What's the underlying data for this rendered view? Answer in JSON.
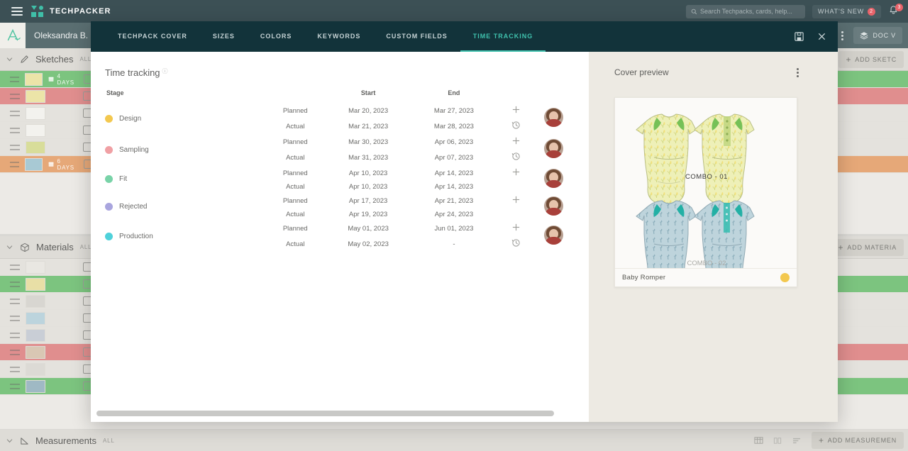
{
  "topbar": {
    "menu_icon": "hamburger-icon",
    "brand": "TECHPACKER",
    "search_placeholder": "Search Techpacks, cards, help...",
    "search_icon": "search-icon",
    "whats_new_label": "WHAT'S NEW",
    "whats_new_badge": "2",
    "bell_icon": "bell-icon",
    "bell_badge": "3"
  },
  "subbar": {
    "logo_glyph": "A",
    "user_name": "Oleksandra B.",
    "filter_icon": "filter-icon",
    "kebab_icon": "kebab-menu-icon",
    "doc_view_label": "DOC V",
    "doc_view_icon": "layers-icon"
  },
  "sections": {
    "sketches": {
      "title": "Sketches",
      "sub": "ALL",
      "icon": "pencil-icon",
      "sort_icon": "sort-icon",
      "add_label": "ADD SKETC",
      "rows": [
        {
          "highlight": "#7cc47f",
          "days": "4 DAYS",
          "swatch": "#ece4a8"
        },
        {
          "highlight": "#e08e8e",
          "days": "",
          "swatch": "#ece4a8"
        },
        {
          "highlight": "",
          "days": "",
          "swatch": "#f3f2ee"
        },
        {
          "highlight": "",
          "days": "",
          "swatch": "#f3f2ee"
        },
        {
          "highlight": "",
          "days": "",
          "swatch": "#d8dd9a"
        },
        {
          "highlight": "#e6a878",
          "days": "6 DAYS",
          "swatch": "#a8c9d4"
        }
      ]
    },
    "materials": {
      "title": "Materials",
      "sub": "ALL",
      "icon": "cube-icon",
      "add_label": "ADD MATERIA",
      "rows": [
        {
          "highlight": "",
          "swatch": "#e9e7e2"
        },
        {
          "highlight": "#7cc47f",
          "swatch": "#e8dfa6"
        },
        {
          "highlight": "",
          "swatch": "#d8d6d1"
        },
        {
          "highlight": "",
          "swatch": "#bcd4dd"
        },
        {
          "highlight": "",
          "swatch": "#c9ced6"
        },
        {
          "highlight": "#e08e8e",
          "swatch": "#d9c7b4"
        },
        {
          "highlight": "",
          "swatch": "#dcdad5"
        },
        {
          "highlight": "#7cc47f",
          "swatch": "#9fb9c4"
        }
      ]
    },
    "measurements": {
      "title": "Measurements",
      "sub": "ALL",
      "icon": "ruler-icon",
      "add_label": "ADD MEASUREMEN"
    }
  },
  "modal": {
    "tabs": [
      {
        "label": "TECHPACK COVER",
        "active": false
      },
      {
        "label": "SIZES",
        "active": false
      },
      {
        "label": "COLORS",
        "active": false
      },
      {
        "label": "KEYWORDS",
        "active": false
      },
      {
        "label": "CUSTOM FIELDS",
        "active": false
      },
      {
        "label": "TIME TRACKING",
        "active": true
      }
    ],
    "save_icon": "save-icon",
    "close_icon": "close-icon",
    "time_tracking": {
      "title": "Time tracking",
      "info_icon": "info-icon",
      "columns": {
        "stage": "Stage",
        "start": "Start",
        "end": "End"
      },
      "row_labels": {
        "planned": "Planned",
        "actual": "Actual"
      },
      "add_icon": "plus-icon",
      "history_icon": "clock-history-icon",
      "avatar_icon": "avatar",
      "stages": [
        {
          "name": "Design",
          "color": "#f3c84f",
          "planned_start": "Mar 20, 2023",
          "planned_end": "Mar 27, 2023",
          "planned_end_late": true,
          "actual_start": "Mar 21, 2023",
          "actual_end": "Mar 28, 2023",
          "has_history": true
        },
        {
          "name": "Sampling",
          "color": "#f0a0a4",
          "planned_start": "Mar 30, 2023",
          "planned_end": "Apr 06, 2023",
          "planned_end_late": true,
          "actual_start": "Mar 31, 2023",
          "actual_end": "Apr 07, 2023",
          "has_history": true
        },
        {
          "name": "Fit",
          "color": "#79d3a8",
          "planned_start": "Apr 10, 2023",
          "planned_end": "Apr 14, 2023",
          "planned_end_late": true,
          "actual_start": "Apr 10, 2023",
          "actual_end": "Apr 14, 2023",
          "has_history": false
        },
        {
          "name": "Rejected",
          "color": "#a9a5de",
          "planned_start": "Apr 17, 2023",
          "planned_end": "Apr 21, 2023",
          "planned_end_late": true,
          "actual_start": "Apr 19, 2023",
          "actual_end": "Apr 24, 2023",
          "has_history": false
        },
        {
          "name": "Production",
          "color": "#4fd1da",
          "planned_start": "May 01, 2023",
          "planned_end": "Jun 01, 2023",
          "planned_end_late": false,
          "actual_start": "May 02, 2023",
          "actual_end": "-",
          "has_history": true
        }
      ]
    },
    "preview": {
      "title": "Cover preview",
      "kebab_icon": "kebab-menu-icon",
      "combo_1_label": "COMBO - 01",
      "combo_2_label": "COMBO - 02",
      "cover_name": "Baby Romper",
      "cover_dot_color": "#f3c84f"
    }
  }
}
